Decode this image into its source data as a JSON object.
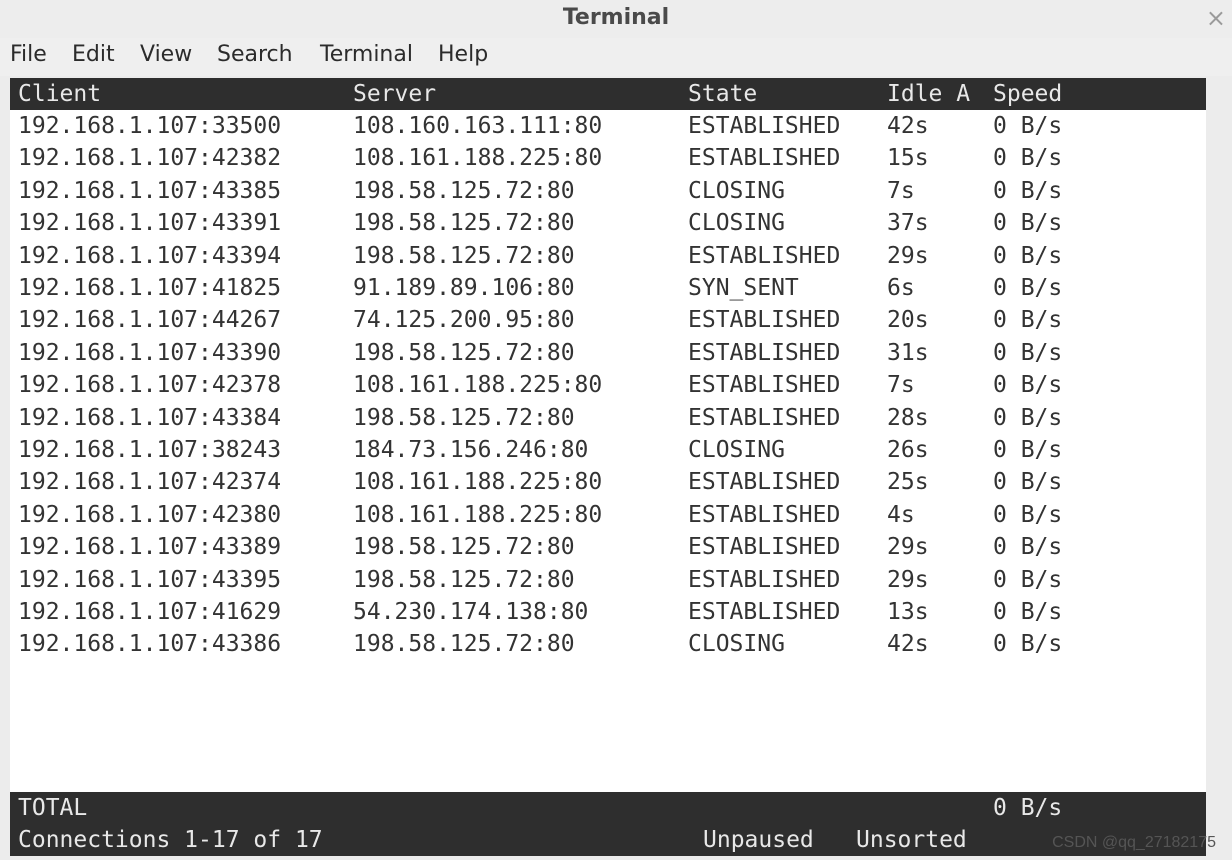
{
  "window": {
    "title": "Terminal",
    "close_symbol": "×"
  },
  "menu": [
    "File",
    "Edit",
    "View",
    "Search",
    "Terminal",
    "Help"
  ],
  "table": {
    "headers": [
      "Client",
      "Server",
      "State",
      "Idle A",
      "Speed"
    ],
    "rows": [
      [
        "192.168.1.107:33500",
        "108.160.163.111:80",
        "ESTABLISHED",
        "42s",
        "0 B/s"
      ],
      [
        "192.168.1.107:42382",
        "108.161.188.225:80",
        "ESTABLISHED",
        "15s",
        "0 B/s"
      ],
      [
        "192.168.1.107:43385",
        "198.58.125.72:80",
        "CLOSING",
        "7s",
        "0 B/s"
      ],
      [
        "192.168.1.107:43391",
        "198.58.125.72:80",
        "CLOSING",
        "37s",
        "0 B/s"
      ],
      [
        "192.168.1.107:43394",
        "198.58.125.72:80",
        "ESTABLISHED",
        "29s",
        "0 B/s"
      ],
      [
        "192.168.1.107:41825",
        "91.189.89.106:80",
        "SYN_SENT",
        "6s",
        "0 B/s"
      ],
      [
        "192.168.1.107:44267",
        "74.125.200.95:80",
        "ESTABLISHED",
        "20s",
        "0 B/s"
      ],
      [
        "192.168.1.107:43390",
        "198.58.125.72:80",
        "ESTABLISHED",
        "31s",
        "0 B/s"
      ],
      [
        "192.168.1.107:42378",
        "108.161.188.225:80",
        "ESTABLISHED",
        "7s",
        "0 B/s"
      ],
      [
        "192.168.1.107:43384",
        "198.58.125.72:80",
        "ESTABLISHED",
        "28s",
        "0 B/s"
      ],
      [
        "192.168.1.107:38243",
        "184.73.156.246:80",
        "CLOSING",
        "26s",
        "0 B/s"
      ],
      [
        "192.168.1.107:42374",
        "108.161.188.225:80",
        "ESTABLISHED",
        "25s",
        "0 B/s"
      ],
      [
        "192.168.1.107:42380",
        "108.161.188.225:80",
        "ESTABLISHED",
        "4s",
        "0 B/s"
      ],
      [
        "192.168.1.107:43389",
        "198.58.125.72:80",
        "ESTABLISHED",
        "29s",
        "0 B/s"
      ],
      [
        "192.168.1.107:43395",
        "198.58.125.72:80",
        "ESTABLISHED",
        "29s",
        "0 B/s"
      ],
      [
        "192.168.1.107:41629",
        "54.230.174.138:80",
        "ESTABLISHED",
        "13s",
        "0 B/s"
      ],
      [
        "192.168.1.107:43386",
        "198.58.125.72:80",
        "CLOSING",
        "42s",
        "0 B/s"
      ]
    ]
  },
  "footer": {
    "total_label": "TOTAL",
    "total_speed": "0 B/s",
    "connections": "Connections 1-17 of 17",
    "pause_status": "Unpaused",
    "sort_status": "Unsorted"
  },
  "watermark": "CSDN @qq_27182175",
  "colors": {
    "terminal_bg": "#ffffff",
    "header_bg": "#2e2e2e",
    "header_fg": "#e8e8e8",
    "text": "#333333",
    "chrome_bg": "#ececec"
  }
}
